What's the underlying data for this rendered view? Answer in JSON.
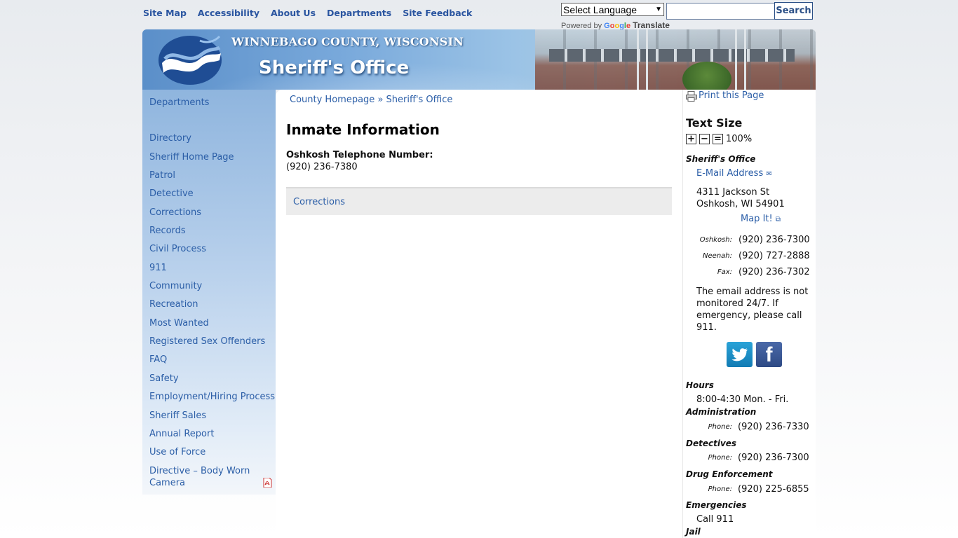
{
  "topnav": {
    "links": [
      "Site Map",
      "Accessibility",
      "About Us",
      "Departments",
      "Site Feedback"
    ]
  },
  "translate": {
    "select_label": "Select Language",
    "powered_by": "Powered by",
    "google": "Google",
    "translate_word": "Translate"
  },
  "search": {
    "placeholder": "",
    "button_label": "Search"
  },
  "banner": {
    "county": "WINNEBAGO COUNTY, WISCONSIN",
    "office": "Sheriff's Office"
  },
  "leftnav": {
    "items": [
      "Departments",
      "Directory",
      "Sheriff Home Page",
      "Patrol",
      "Detective",
      "Corrections",
      "Records",
      "Civil Process",
      "911",
      "Community",
      "Recreation",
      "Most Wanted",
      "Registered Sex Offenders",
      "FAQ",
      "Safety",
      "Employment/Hiring Process",
      "Sheriff Sales",
      "Annual Report",
      "Use of Force",
      "Directive – Body Worn Camera"
    ]
  },
  "main": {
    "breadcrumb_home": "County Homepage",
    "breadcrumb_sep": "»",
    "breadcrumb_current": "Sheriff's Office",
    "title": "Inmate Information",
    "phone_label": "Oshkosh Telephone Number:",
    "phone_value": "(920) 236-7380",
    "sublink": "Corrections"
  },
  "sidebar": {
    "print": "Print this Page",
    "text_size_title": "Text Size",
    "text_size_pct": "100%",
    "office_name": "Sheriff's Office",
    "email": "E-Mail Address",
    "address1": "4311 Jackson St",
    "address2": "Oshkosh, WI 54901",
    "map": "Map It!",
    "phones": [
      {
        "label": "Oshkosh:",
        "value": "(920) 236-7300"
      },
      {
        "label": "Neenah:",
        "value": "(920) 727-2888"
      },
      {
        "label": "Fax:",
        "value": "(920) 236-7302"
      }
    ],
    "notice": [
      "The email address is not",
      "monitored 24/7. If",
      "emergency, please call",
      "911."
    ],
    "hours_title": "Hours",
    "hours_value": "8:00-4:30 Mon. - Fri.",
    "admin_title": "Administration",
    "admin_label": "Phone:",
    "admin_value": "(920) 236-7330",
    "det_title": "Detectives",
    "det_label": "Phone:",
    "det_value": "(920) 236-7300",
    "drug_title": "Drug Enforcement",
    "drug_label": "Phone:",
    "drug_value": "(920) 225-6855",
    "emerg_title": "Emergencies",
    "emerg_value": "Call 911",
    "jail_title": "Jail"
  }
}
